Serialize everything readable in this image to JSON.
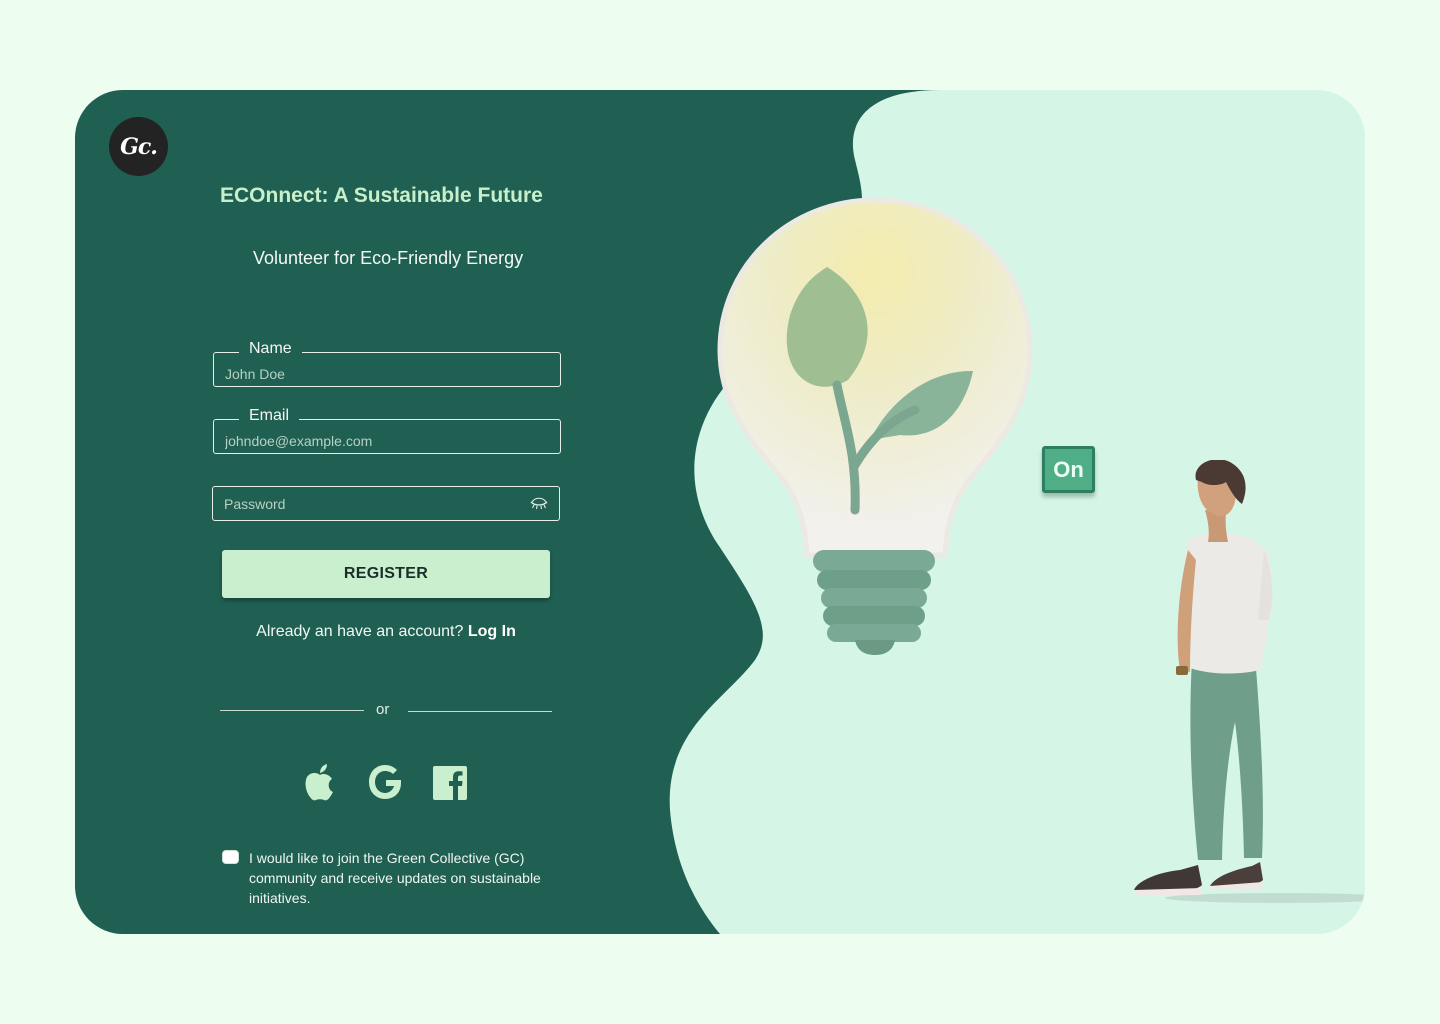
{
  "brand": {
    "logo_text": "Gc."
  },
  "header": {
    "title": "ECOnnect: A Sustainable Future",
    "subtitle": "Volunteer for Eco-Friendly Energy"
  },
  "form": {
    "name": {
      "label": "Name",
      "placeholder": "John Doe"
    },
    "email": {
      "label": "Email",
      "placeholder": "johndoe@example.com"
    },
    "password": {
      "placeholder": "Password",
      "toggle_icon": "eye-closed-icon"
    },
    "register_label": "REGISTER",
    "login_prompt": "Already an have an account?",
    "login_link": "Log In",
    "divider_text": "or",
    "social": [
      {
        "name": "apple",
        "icon": "apple-icon"
      },
      {
        "name": "google",
        "icon": "google-icon"
      },
      {
        "name": "facebook",
        "icon": "facebook-icon"
      }
    ],
    "consent": {
      "checked": false,
      "text": "I would like to join the Green Collective (GC) community and receive updates on sustainable initiatives."
    }
  },
  "illustration": {
    "switch_label": "On"
  },
  "colors": {
    "page_bg": "#edfdf0",
    "panel_dark": "#206052",
    "panel_light": "#d5f5e6",
    "accent": "#c9efcf",
    "switch": "#4fae86"
  }
}
